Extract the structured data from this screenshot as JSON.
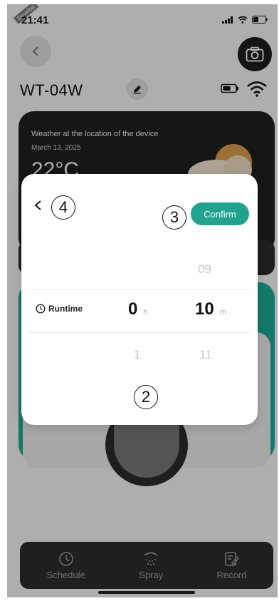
{
  "status_bar": {
    "time": "21:41",
    "dev_tag": "Develop"
  },
  "header": {
    "device_name": "WT-04W"
  },
  "weather": {
    "title": "Weather at the location of the device",
    "date": "March 13, 2025",
    "temperature": "22°C"
  },
  "picker": {
    "confirm_label": "Confirm",
    "runtime_label": "Runtime",
    "hours": {
      "above": "",
      "selected": "0",
      "below": "1",
      "unit": "h"
    },
    "minutes": {
      "above": "09",
      "selected": "10",
      "below": "11",
      "unit": "m"
    }
  },
  "annotations": {
    "badge_2": "2",
    "badge_3": "3",
    "badge_4": "4"
  },
  "tabbar": {
    "tabs": [
      {
        "label": "Schedule",
        "icon": "clock-icon"
      },
      {
        "label": "Spray",
        "icon": "spray-icon"
      },
      {
        "label": "Record",
        "icon": "record-icon"
      }
    ]
  },
  "colors": {
    "accent": "#20a48f",
    "dark_card": "#1f1f1f"
  }
}
